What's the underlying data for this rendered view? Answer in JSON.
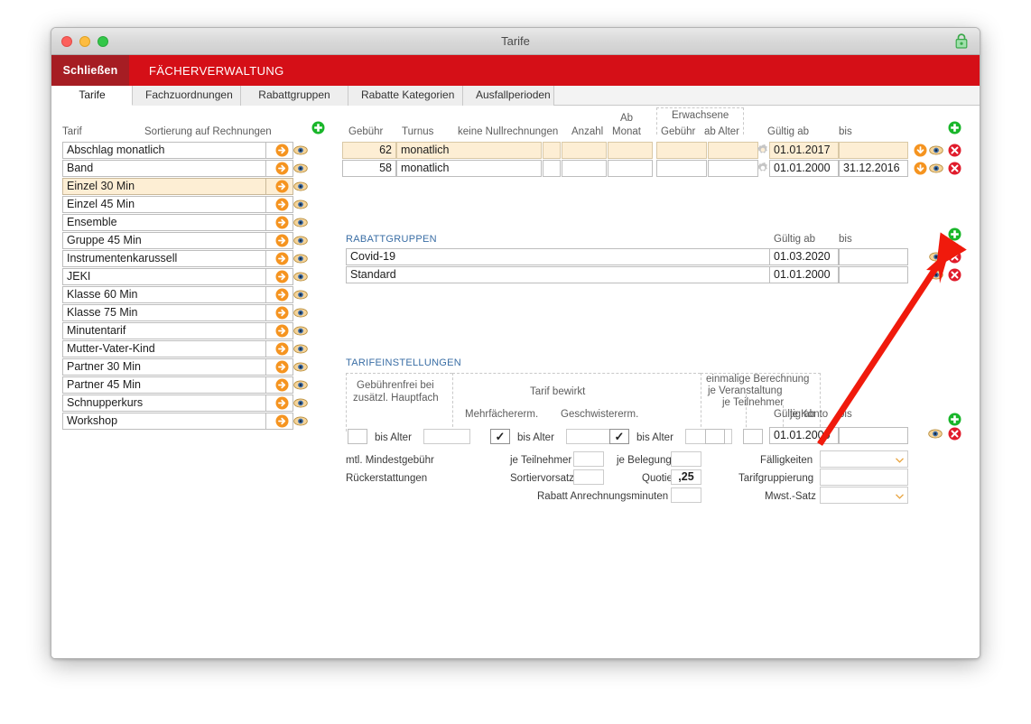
{
  "window": {
    "title": "Tarife",
    "lock_icon": "lock-closed-icon",
    "traffic_lights": [
      "close",
      "minimize",
      "zoom"
    ]
  },
  "menubar": {
    "close_label": "Schließen",
    "module_title": "FÄCHERVERWALTUNG",
    "bg_color": "#d50f17",
    "close_bg_color": "#a61d23"
  },
  "tabs": [
    {
      "label": "Tarife",
      "active": true
    },
    {
      "label": "Fachzuordnungen",
      "active": false
    },
    {
      "label": "Rabattgruppen",
      "active": false
    },
    {
      "label": "Rabatte Kategorien",
      "active": false
    },
    {
      "label": "Ausfallperioden",
      "active": false
    }
  ],
  "tariff_list": {
    "header_name": "Tarif",
    "header_sort": "Sortierung auf Rechnungen",
    "add_icon": "plus-circle-green-icon",
    "row_icons": [
      "arrow-right-circle-orange-icon",
      "eye-icon"
    ],
    "items": [
      {
        "name": "Abschlag monatlich",
        "sort": "",
        "selected": false
      },
      {
        "name": "Band",
        "sort": "",
        "selected": false
      },
      {
        "name": "Einzel 30 Min",
        "sort": "",
        "selected": true
      },
      {
        "name": "Einzel 45 Min",
        "sort": "",
        "selected": false
      },
      {
        "name": "Ensemble",
        "sort": "",
        "selected": false
      },
      {
        "name": "Gruppe 45 Min",
        "sort": "",
        "selected": false
      },
      {
        "name": "Instrumentenkarussell",
        "sort": "",
        "selected": false
      },
      {
        "name": "JEKI",
        "sort": "",
        "selected": false
      },
      {
        "name": "Klasse 60 Min",
        "sort": "",
        "selected": false
      },
      {
        "name": "Klasse 75 Min",
        "sort": "",
        "selected": false
      },
      {
        "name": "Minutentarif",
        "sort": "",
        "selected": false
      },
      {
        "name": "Mutter-Vater-Kind",
        "sort": "",
        "selected": false
      },
      {
        "name": "Partner 30 Min",
        "sort": "",
        "selected": false
      },
      {
        "name": "Partner 45 Min",
        "sort": "",
        "selected": false
      },
      {
        "name": "Schnupperkurs",
        "sort": "",
        "selected": false
      },
      {
        "name": "Workshop",
        "sort": "",
        "selected": false
      }
    ]
  },
  "fee_table": {
    "group_header": "Erwachsene",
    "headers": {
      "gebuehr": "Gebühr",
      "turnus": "Turnus",
      "keine_nullrechnungen": "keine Nullrechnungen",
      "anzahl": "Anzahl",
      "ab_monat_line1": "Ab",
      "ab_monat_line2": "Monat",
      "erw_gebuehr": "Gebühr",
      "erw_ab_alter": "ab Alter",
      "gueltig_ab": "Gültig ab",
      "bis": "bis"
    },
    "add_icon": "plus-circle-green-icon",
    "row_icons": [
      "arrow-down-circle-orange-icon",
      "eye-icon",
      "delete-circle-red-icon"
    ],
    "settings_icon": "gear-icon",
    "rows": [
      {
        "gebuehr": "62",
        "turnus": "monatlich",
        "keine_nullrechnungen": "",
        "anzahl": "",
        "ab_monat": "",
        "erw_gebuehr": "",
        "erw_ab_alter": "",
        "gueltig_ab": "01.01.2017",
        "bis": "",
        "highlighted": true
      },
      {
        "gebuehr": "58",
        "turnus": "monatlich",
        "keine_nullrechnungen": "",
        "anzahl": "",
        "ab_monat": "",
        "erw_gebuehr": "",
        "erw_ab_alter": "",
        "gueltig_ab": "01.01.2000",
        "bis": "31.12.2016",
        "highlighted": false
      }
    ]
  },
  "rabattgruppen": {
    "title": "RABATTGRUPPEN",
    "header_gueltig_ab": "Gültig ab",
    "header_bis": "bis",
    "add_icon": "plus-circle-green-icon",
    "row_icons": [
      "eye-icon",
      "delete-circle-red-icon"
    ],
    "rows": [
      {
        "name": "Covid-19",
        "gueltig_ab": "01.03.2020",
        "bis": ""
      },
      {
        "name": "Standard",
        "gueltig_ab": "01.01.2000",
        "bis": ""
      }
    ]
  },
  "tarifeinstellungen": {
    "title": "TARIFEINSTELLUNGEN",
    "group_gebuehrenfrei_line1": "Gebührenfrei bei",
    "group_gebuehrenfrei_line2": "zusätzl. Hauptfach",
    "group_tarif_bewirkt": "Tarif bewirkt",
    "group_einmalig_line1": "einmalige Berechnung",
    "group_einmalig_line2": "je Veranstaltung",
    "group_einmalig_line3": "je Teilnehmer",
    "group_einmalig_line4": "je Konto",
    "sub_mehrfacherm": "Mehrfächererm.",
    "sub_geschwistererm": "Geschwistererm.",
    "row1": {
      "gf_bis_alter_label": "bis Alter",
      "gf_bis_alter_value": "",
      "gf_checked": false,
      "mf_checked": true,
      "mf_bis_alter_label": "bis Alter",
      "mf_bis_alter_value": "",
      "gw_checked": true,
      "gw_bis_alter_label": "bis Alter",
      "gw_bis_alter_value": "",
      "einmalig_veranstaltung": "",
      "einmalig_teilnehmer": "",
      "einmalig_konto": "",
      "gueltig_ab_label": "Gültig ab",
      "gueltig_ab_value": "01.01.2000",
      "bis_label": "bis",
      "bis_value": ""
    },
    "row2": {
      "mtl_mindestgebuehr": "mtl. Mindestgebühr",
      "je_teilnehmer_label": "je Teilnehmer",
      "je_teilnehmer_value": "",
      "je_belegung_label": "je Belegung",
      "je_belegung_value": "",
      "faelligkeiten_label": "Fälligkeiten",
      "faelligkeiten_value": ""
    },
    "row3": {
      "rueckerstattungen": "Rückerstattungen",
      "sortiervorsatz_label": "Sortiervorsatz",
      "sortiervorsatz_value": "",
      "quotient_label": "Quotient",
      "quotient_value": ",25",
      "tarifgruppierung_label": "Tarifgruppierung",
      "tarifgruppierung_value": ""
    },
    "row4": {
      "rabatt_anrechnungsminuten_label": "Rabatt Anrechnungsminuten",
      "rabatt_anrechnungsminuten_value": "",
      "mwst_label": "Mwst.-Satz",
      "mwst_value": ""
    },
    "add_icon": "plus-circle-green-icon",
    "row_icons": [
      "eye-icon",
      "delete-circle-red-icon"
    ]
  },
  "annotation": {
    "type": "red-arrow",
    "color": "#f01a0c",
    "points_to": "rabattgruppen-add-button"
  }
}
